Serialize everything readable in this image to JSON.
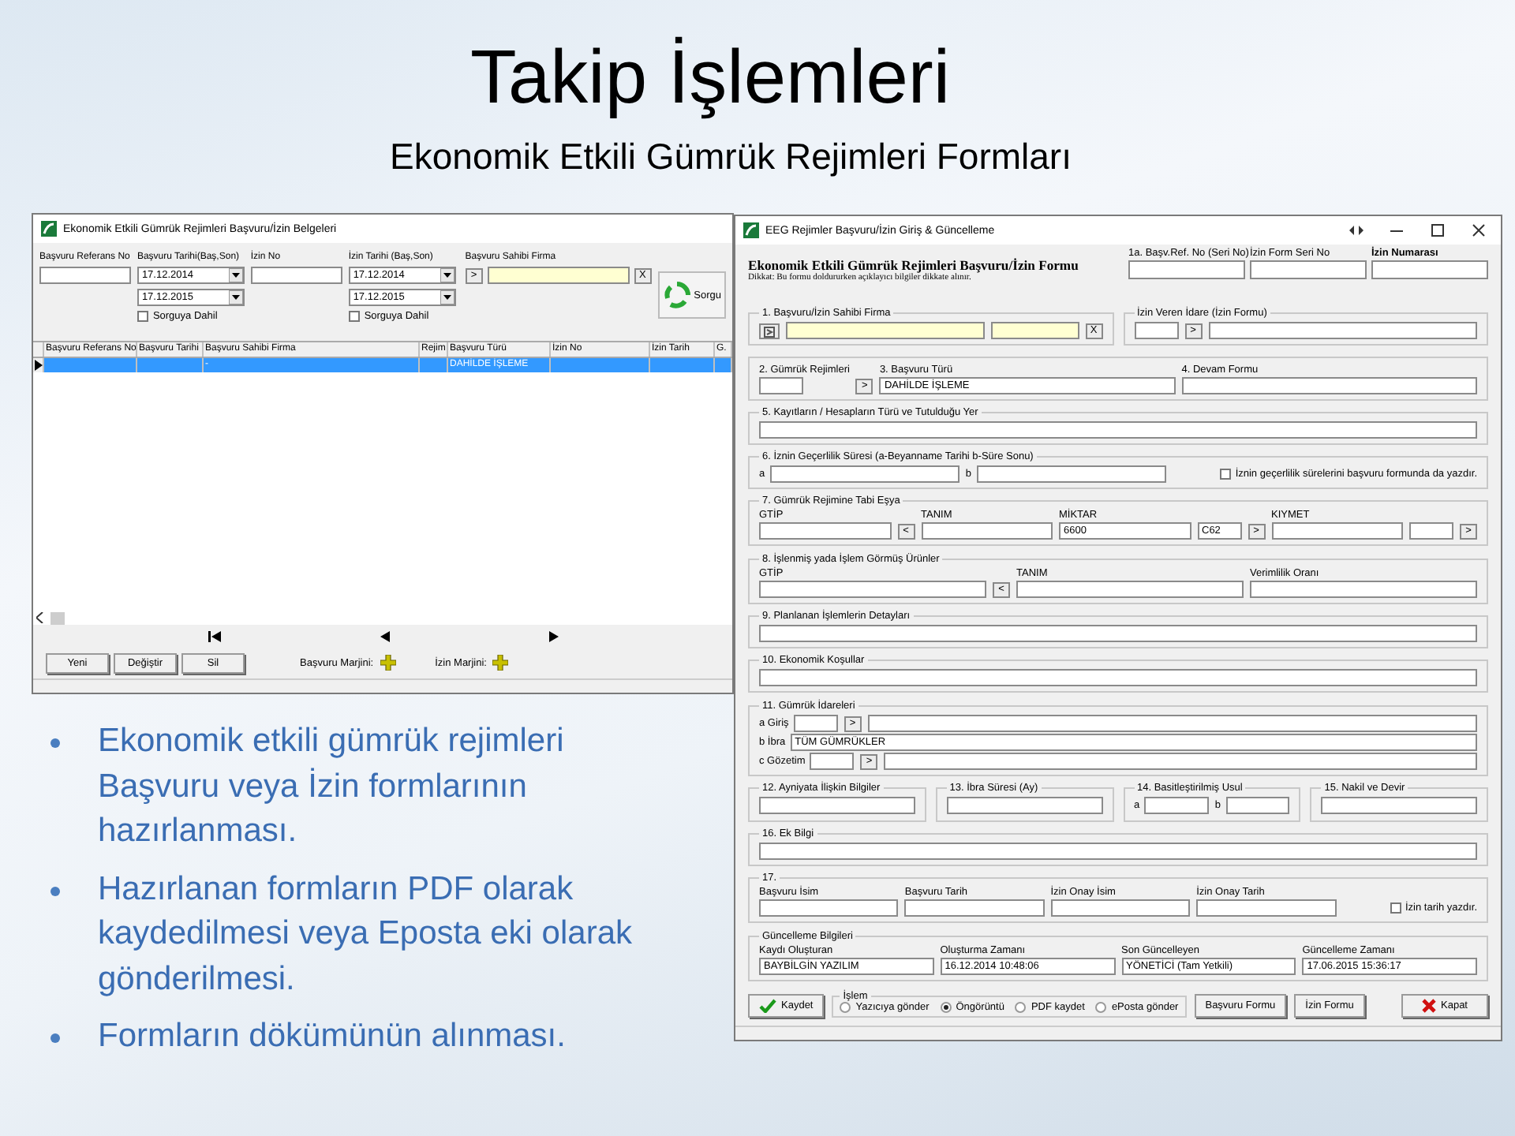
{
  "slide": {
    "title": "Takip İşlemleri",
    "subtitle": "Ekonomik Etkili Gümrük Rejimleri Formları",
    "bullets": [
      "Ekonomik etkili gümrük rejimleri Başvuru veya İzin formlarının hazırlanması.",
      "Hazırlanan formların PDF olarak kaydedilmesi veya Eposta eki olarak gönderilmesi.",
      "Formların dökümünün alınması."
    ]
  },
  "list_window": {
    "title": "Ekonomik Etkili Gümrük Rejimleri Başvuru/İzin Belgeleri",
    "filters": [
      {
        "kind": "text",
        "label": "Başvuru Referans No"
      },
      {
        "kind": "dates",
        "label": "Başvuru Tarihi(Baş,Son)",
        "dates": [
          "17.12.2014",
          "17.12.2015"
        ],
        "checkbox": {
          "label": "Sorguya Dahil",
          "checked": false
        }
      },
      {
        "kind": "text",
        "label": "İzin No"
      },
      {
        "kind": "dates",
        "label": "İzin Tarihi (Baş,Son)",
        "dates": [
          "17.12.2014",
          "17.12.2015"
        ],
        "checkbox": {
          "label": "Sorguya Dahil",
          "checked": false
        }
      },
      {
        "kind": "lookup",
        "label": "Başvuru Sahibi Firma",
        "pick": ">",
        "clear": "X"
      }
    ],
    "query_button": "Sorgu",
    "table": {
      "columns": [
        "Başvuru Referans No",
        "Başvuru Tarihi",
        "Başvuru Sahibi Firma",
        "Rejim",
        "Başvuru Türü",
        "İzin No",
        "İzin Tarih",
        "G."
      ],
      "rows": [
        {
          "selected": true,
          "cells": [
            "",
            "",
            "-",
            "",
            "DAHİLDE İŞLEME",
            "",
            "",
            ""
          ]
        }
      ]
    },
    "buttons": [
      "Yeni",
      "Değiştir",
      "Sil"
    ],
    "margins": [
      "Başvuru Marjini:",
      "İzin Marjini:"
    ]
  },
  "form_window": {
    "title": "EEG Rejimler Başvuru/İzin Giriş & Güncelleme",
    "heading": "Ekonomik Etkili Gümrük Rejimleri Başvuru/İzin Formu",
    "notice": "Dikkat: Bu formu doldururken açıklayıcı bilgiler dikkate alınır.",
    "header_fields": [
      {
        "label": "1a. Başv.Ref. No (Seri No)",
        "emphasis": false
      },
      {
        "label": "İzin Form Seri No",
        "emphasis": false
      },
      {
        "label": "İzin Numarası",
        "emphasis": true
      }
    ],
    "lines": [
      [
        {
          "title": "1. Başvuru/İzin Sahibi Firma",
          "rows": [
            [
              {
                "kind": "icon_button"
              },
              {
                "kind": "lookup"
              },
              {
                "kind": "lookup_short"
              },
              {
                "kind": "button",
                "text": "X"
              }
            ]
          ]
        },
        {
          "title": "İzin Veren İdare (İzin Formu)",
          "rows": [
            [
              {
                "kind": "code"
              },
              {
                "kind": "button",
                "text": ">"
              },
              {
                "kind": "field"
              }
            ]
          ]
        }
      ],
      [
        {
          "rows": [
            [
              {
                "kind": "code",
                "label": "2. Gümrük Rejimleri"
              },
              {
                "kind": "button",
                "text": ">"
              },
              {
                "kind": "field",
                "label": "3. Başvuru Türü",
                "value": "DAHİLDE İŞLEME"
              },
              {
                "kind": "field",
                "label": "4. Devam Formu"
              }
            ]
          ]
        }
      ],
      [
        {
          "title": "5. Kayıtların / Hesapların Türü ve Tutulduğu Yer",
          "rows": [
            [
              {
                "kind": "field"
              }
            ]
          ]
        }
      ],
      [
        {
          "title": "6. İznin Geçerlilik Süresi (a-Beyanname Tarihi b-Süre Sonu)",
          "rows": [
            [
              {
                "kind": "field",
                "prefix": "a"
              },
              {
                "kind": "field",
                "prefix": "b"
              },
              {
                "kind": "checkbox",
                "text": "İznin geçerlilik sürelerini başvuru formunda da yazdır.",
                "checked": false
              }
            ]
          ]
        }
      ],
      [
        {
          "title": "7. Gümrük Rejimine Tabi Eşya",
          "rows": [
            [
              {
                "kind": "field",
                "label": "GTİP"
              },
              {
                "kind": "button",
                "text": "<"
              },
              {
                "kind": "field",
                "label": "TANIM"
              },
              {
                "kind": "field",
                "label": "MİKTAR",
                "value": "6600"
              },
              {
                "kind": "code",
                "value": "C62"
              },
              {
                "kind": "button",
                "text": ">"
              },
              {
                "kind": "field",
                "label": "KIYMET"
              },
              {
                "kind": "code"
              },
              {
                "kind": "button",
                "text": ">"
              }
            ]
          ]
        }
      ],
      [
        {
          "title": "8. İşlenmiş yada İşlem Görmüş Ürünler",
          "rows": [
            [
              {
                "kind": "field",
                "label": "GTİP"
              },
              {
                "kind": "button",
                "text": "<"
              },
              {
                "kind": "field",
                "label": "TANIM"
              },
              {
                "kind": "field",
                "label": "Verimlilik Oranı"
              }
            ]
          ]
        }
      ],
      [
        {
          "title": "9. Planlanan İşlemlerin Detayları",
          "rows": [
            [
              {
                "kind": "field"
              }
            ]
          ]
        }
      ],
      [
        {
          "title": "10. Ekonomik Koşullar",
          "rows": [
            [
              {
                "kind": "field"
              }
            ]
          ]
        }
      ],
      [
        {
          "title": "11. Gümrük İdareleri",
          "rows": [
            [
              {
                "kind": "code",
                "prefix": "a Giriş"
              },
              {
                "kind": "button",
                "text": ">"
              },
              {
                "kind": "field"
              }
            ],
            [
              {
                "kind": "field",
                "prefix": "b İbra",
                "value": "TÜM GÜMRÜKLER"
              }
            ],
            [
              {
                "kind": "code",
                "prefix": "c Gözetim"
              },
              {
                "kind": "button",
                "text": ">"
              },
              {
                "kind": "field"
              }
            ]
          ]
        }
      ],
      [
        {
          "title": "12. Ayniyata İlişkin Bilgiler",
          "rows": [
            [
              {
                "kind": "field"
              }
            ]
          ]
        },
        {
          "title": "13. İbra Süresi (Ay)",
          "rows": [
            [
              {
                "kind": "field"
              }
            ]
          ]
        },
        {
          "title": "14. Basitleştirilmiş Usul",
          "rows": [
            [
              {
                "kind": "field",
                "prefix": "a"
              },
              {
                "kind": "field",
                "prefix": "b"
              }
            ]
          ]
        },
        {
          "title": "15. Nakil ve Devir",
          "rows": [
            [
              {
                "kind": "field"
              }
            ]
          ]
        }
      ],
      [
        {
          "title": "16. Ek Bilgi",
          "rows": [
            [
              {
                "kind": "field"
              }
            ]
          ]
        }
      ],
      [
        {
          "title": "17.",
          "rows": [
            [
              {
                "kind": "field",
                "label": "Başvuru İsim"
              },
              {
                "kind": "field",
                "label": "Başvuru Tarih"
              },
              {
                "kind": "field",
                "label": "İzin Onay İsim"
              },
              {
                "kind": "field",
                "label": "İzin Onay Tarih"
              },
              {
                "kind": "checkbox",
                "text": "İzin tarih yazdır.",
                "checked": false
              }
            ]
          ]
        }
      ],
      [
        {
          "title": "Güncelleme Bilgileri",
          "rows": [
            [
              {
                "kind": "field",
                "label": "Kaydı Oluşturan",
                "value": "BAYBİLGİN YAZILIM"
              },
              {
                "kind": "field",
                "label": "Oluşturma Zamanı",
                "value": "16.12.2014 10:48:06"
              },
              {
                "kind": "field",
                "label": "Son Güncelleyen",
                "value": "YÖNETİCİ (Tam Yetkili)"
              },
              {
                "kind": "field",
                "label": "Güncelleme Zamanı",
                "value": "17.06.2015 15:36:17"
              }
            ]
          ]
        }
      ]
    ],
    "actions": [
      {
        "kind": "save",
        "text": "Kaydet"
      },
      {
        "kind": "radio_group",
        "title": "İşlem",
        "options": [
          {
            "label": "Yazıcıya gönder",
            "selected": false
          },
          {
            "label": "Öngörüntü",
            "selected": true
          },
          {
            "label": "PDF kaydet",
            "selected": false
          },
          {
            "label": "ePosta gönder",
            "selected": false
          }
        ]
      },
      {
        "kind": "button",
        "text": "Başvuru Formu"
      },
      {
        "kind": "button",
        "text": "İzin Formu"
      },
      {
        "kind": "close",
        "text": "Kapat"
      }
    ]
  }
}
